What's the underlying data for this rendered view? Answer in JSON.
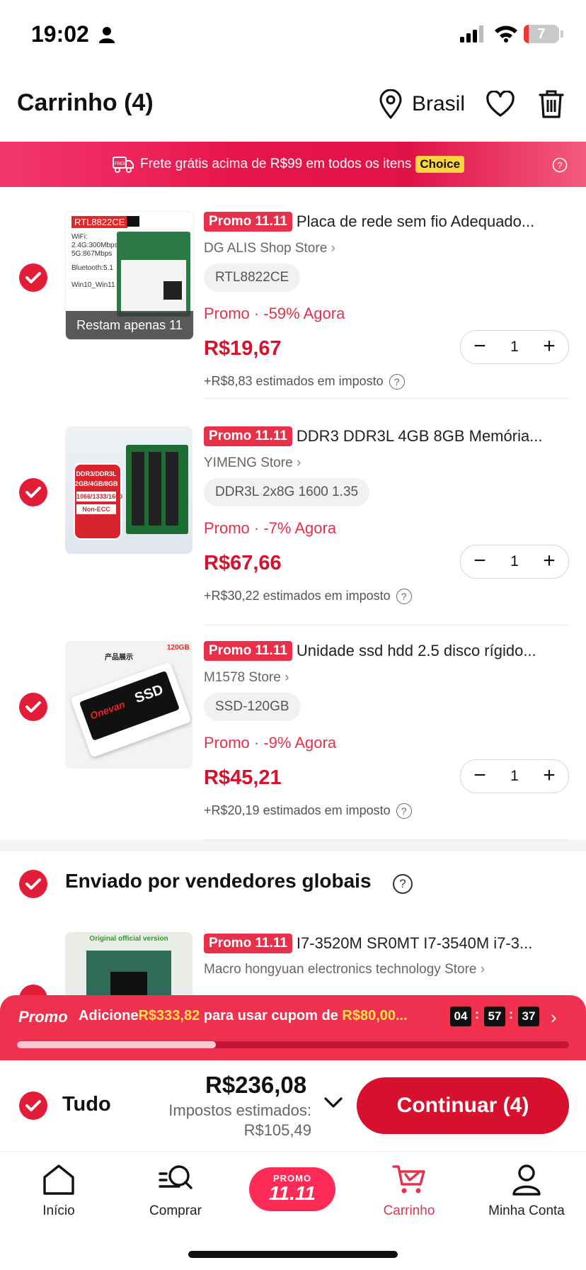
{
  "status_bar": {
    "time": "19:02",
    "battery": "7"
  },
  "header": {
    "title": "Carrinho (4)",
    "location": "Brasil"
  },
  "banner": {
    "text": "Frete grátis acima de R$99 em todos os itens",
    "badge": "Choice",
    "truck_text": "FREE"
  },
  "items": [
    {
      "tag": "Promo 11.11",
      "title": "Placa de rede sem fio Adequado...",
      "store": "DG ALIS Shop Store",
      "variant": "RTL8822CE",
      "discount": "Promo · -59% Agora",
      "price": "R$19,67",
      "quantity": "1",
      "tax": "+R$8,83 estimados em imposto",
      "stock_overlay": "Restam apenas 11",
      "thumb_label": "RTL8822CE",
      "thumb_specs": [
        "WiFi:",
        "2.4G:300Mbps",
        "5G:867Mbps",
        "Bluetooth:5.1",
        "Win10_Win11"
      ]
    },
    {
      "tag": "Promo 11.11",
      "title": "DDR3 DDR3L 4GB 8GB Memória...",
      "store": "YIMENG Store",
      "variant": "DDR3L 2x8G 1600 1.35",
      "discount": "Promo · -7% Agora",
      "price": "R$67,66",
      "quantity": "1",
      "tax": "+R$30,22 estimados em imposto",
      "thumb_specs": [
        "DDR3/DDR3L",
        "2GB/4GB/8GB",
        "1066/1333/1600",
        "Non-ECC"
      ]
    },
    {
      "tag": "Promo 11.11",
      "title": "Unidade ssd hdd 2.5 disco rígido...",
      "store": "M1578 Store",
      "variant": "SSD-120GB",
      "discount": "Promo · -9% Agora",
      "price": "R$45,21",
      "quantity": "1",
      "tax": "+R$20,19 estimados em imposto",
      "thumb_specs": [
        "120GB",
        "产品展示",
        "SSD",
        "Onevan"
      ]
    }
  ],
  "global_section": {
    "title": "Enviado por vendedores globais",
    "item": {
      "tag": "Promo 11.11",
      "title": "I7-3520M SR0MT I7-3540M i7-3...",
      "store": "Macro hongyuan electronics technology Store",
      "thumb_label": "Original official version"
    }
  },
  "coupon_bar": {
    "logo": "Promo",
    "msg_prefix": "Adicione",
    "amount": "R$333,82",
    "msg_mid": " para usar cupom de ",
    "coupon": "R$80,00...",
    "timer": [
      "04",
      "57",
      "37"
    ],
    "progress": 0.36
  },
  "checkout": {
    "select_all": "Tudo",
    "total": "R$236,08",
    "tax_label": "Impostos estimados:",
    "tax_value": "R$105,49",
    "button": "Continuar (4)"
  },
  "tabbar": {
    "tabs": [
      {
        "label": "Início",
        "icon": "home-icon"
      },
      {
        "label": "Comprar",
        "icon": "search-list-icon"
      },
      {
        "label": "",
        "icon": "promo-icon"
      },
      {
        "label": "Carrinho",
        "icon": "cart-icon"
      },
      {
        "label": "Minha Conta",
        "icon": "account-icon"
      }
    ],
    "promo_pill": {
      "line1": "PROMO",
      "line2": "11.11"
    }
  },
  "colors": {
    "accent": "#e31c37",
    "price": "#d8102c",
    "banner": "#e8164a",
    "coupon": "#f0304f"
  }
}
